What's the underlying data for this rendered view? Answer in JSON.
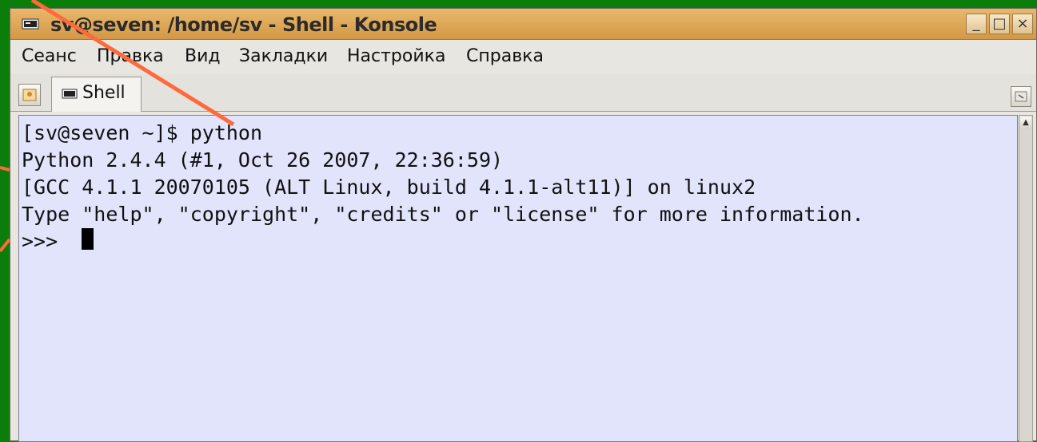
{
  "window": {
    "title": "sv@seven: /home/sv - Shell - Konsole",
    "minimize_label": "_",
    "maximize_label": "□",
    "close_label": "×"
  },
  "menubar": {
    "items": [
      {
        "label": "Сеанс"
      },
      {
        "label": "Правка"
      },
      {
        "label": "Вид"
      },
      {
        "label": "Закладки"
      },
      {
        "label": "Настройка"
      },
      {
        "label": "Справка"
      }
    ]
  },
  "tabs": [
    {
      "label": "Shell",
      "active": true
    }
  ],
  "terminal": {
    "lines": [
      "[sv@seven ~]$ python",
      "Python 2.4.4 (#1, Oct 26 2007, 22:36:59)",
      "[GCC 4.1.1 20070105 (ALT Linux, build 4.1.1-alt11)] on linux2",
      "Type \"help\", \"copyright\", \"credits\" or \"license\" for more information.",
      ">>> "
    ]
  },
  "icons": {
    "window": "terminal-icon",
    "tab": "terminal-icon",
    "new_tab": "new-session-icon",
    "close_tab": "close-session-icon"
  },
  "colors": {
    "background": "#0b7d0b",
    "titlebar": "#d9a555",
    "terminal_bg": "#e1e4fb",
    "annotation_line": "#ff6a3d"
  }
}
